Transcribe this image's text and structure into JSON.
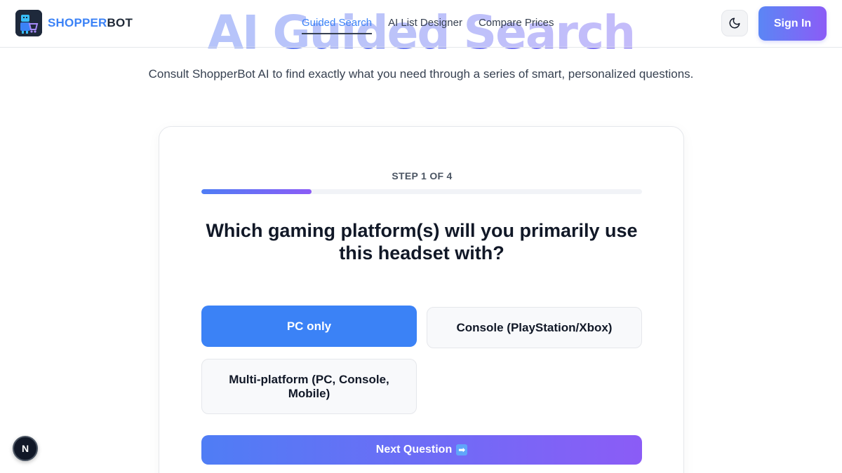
{
  "brand": {
    "part1": "SHOPPER",
    "part2": "BOT"
  },
  "nav": {
    "items": [
      {
        "label": "Guided Search",
        "active": true
      },
      {
        "label": "AI List Designer",
        "active": false
      },
      {
        "label": "Compare Prices",
        "active": false
      }
    ]
  },
  "header": {
    "theme_icon": "moon-icon",
    "signin_label": "Sign In"
  },
  "hero": {
    "title": "AI Guided Search",
    "subtitle": "Consult ShopperBot AI to find exactly what you need through a series of smart, personalized questions."
  },
  "wizard": {
    "step_label": "STEP 1 OF 4",
    "progress": 0.25,
    "question": "Which gaming platform(s) will you primarily use this headset with?",
    "options": [
      {
        "label": "PC only",
        "selected": true
      },
      {
        "label": "Console (PlayStation/Xbox)",
        "selected": false
      },
      {
        "label": "Multi-platform (PC, Console, Mobile)",
        "selected": false
      }
    ],
    "next_label": "Next Question",
    "next_icon": "right-arrow-icon",
    "next_icon_glyph": "➡"
  },
  "badge": {
    "label": "N"
  },
  "colors": {
    "accent": "#3b82f6",
    "gradient_start": "#4f7df5",
    "gradient_end": "#8b5cf6"
  }
}
